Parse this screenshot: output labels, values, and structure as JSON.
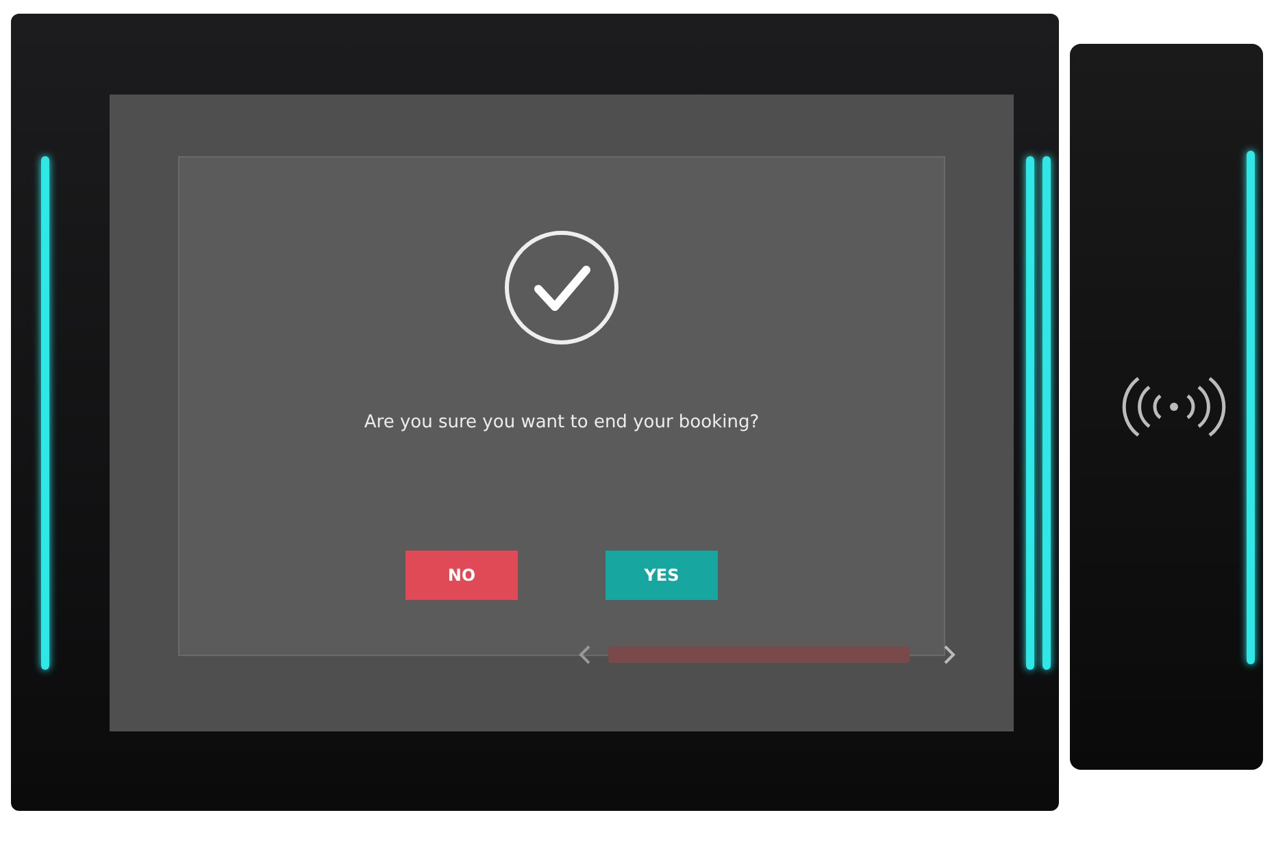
{
  "dialog": {
    "message": "Are you sure you want to end your booking?",
    "buttons": [
      {
        "label": "NO",
        "kind": "cancel"
      },
      {
        "label": "YES",
        "kind": "confirm"
      }
    ]
  }
}
